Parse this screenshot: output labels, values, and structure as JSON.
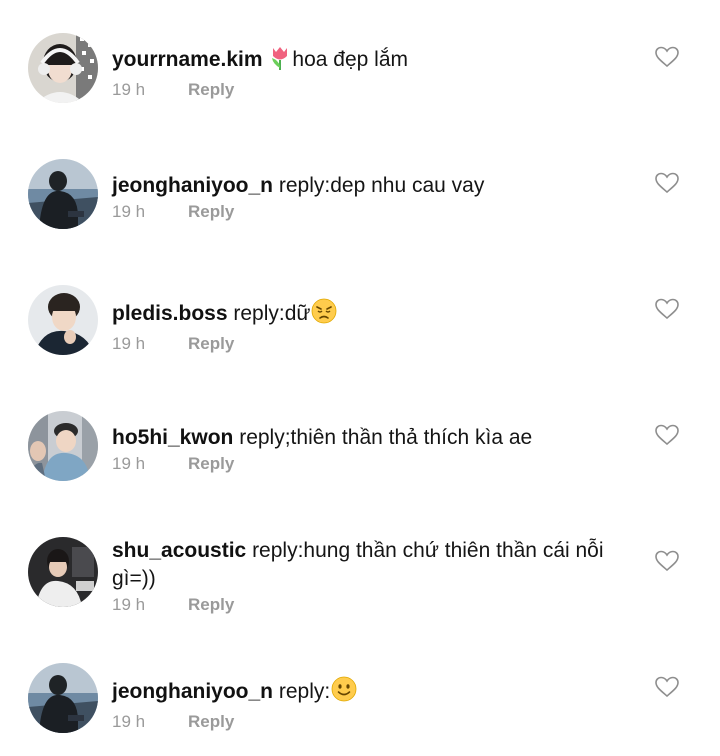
{
  "comments": [
    {
      "username": "yourrname.kim",
      "text": "hoa đẹp lắm",
      "emoji_before": "tulip-emoji",
      "emoji_after": "",
      "time": "19 h",
      "reply_label": "Reply"
    },
    {
      "username": "jeonghaniyoo_n",
      "text": "reply:dep nhu cau vay",
      "emoji_before": "",
      "emoji_after": "",
      "time": "19 h",
      "reply_label": "Reply"
    },
    {
      "username": "pledis.boss",
      "text": "reply:dữ",
      "emoji_before": "",
      "emoji_after": "disappointed-face-emoji",
      "time": "19 h",
      "reply_label": "Reply"
    },
    {
      "username": "ho5hi_kwon",
      "text": "reply;thiên thần thả thích kìa ae",
      "emoji_before": "",
      "emoji_after": "",
      "time": "19 h",
      "reply_label": "Reply"
    },
    {
      "username": "shu_acoustic",
      "text": "reply:hung thần chứ thiên thần cái nỗi gì=))",
      "emoji_before": "",
      "emoji_after": "",
      "time": "19 h",
      "reply_label": "Reply"
    },
    {
      "username": "jeonghaniyoo_n",
      "text": "reply:",
      "emoji_before": "",
      "emoji_after": "slightly-smiling-face-emoji",
      "time": "19 h",
      "reply_label": "Reply"
    }
  ],
  "colors": {
    "text": "#151515",
    "meta": "#9a9a9a",
    "heart_stroke": "#8e8e8e",
    "background": "#ffffff"
  }
}
